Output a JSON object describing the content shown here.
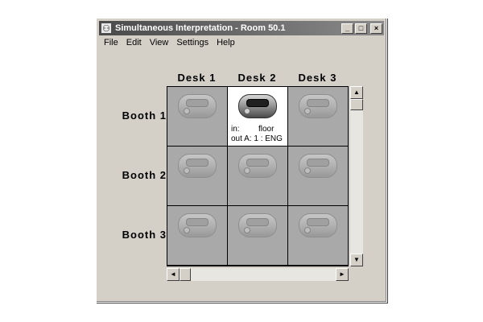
{
  "window": {
    "title": "Simultaneous Interpretation - Room 50.1",
    "app_icon": "interpreter-icon",
    "controls": {
      "minimize": "_",
      "maximize": "□",
      "close": "×"
    }
  },
  "menu": [
    "File",
    "Edit",
    "View",
    "Settings",
    "Help"
  ],
  "columns": [
    "Desk   1",
    "Desk   2",
    "Desk   3"
  ],
  "rows": [
    "Booth   1",
    "Booth   2",
    "Booth   3"
  ],
  "active_cell": {
    "booth": 1,
    "desk": 2,
    "in_label": "in:",
    "in_value": "floor",
    "out_label": "out A:",
    "out_value": "1 : ENG"
  },
  "scroll": {
    "up": "▲",
    "down": "▼",
    "left": "◄",
    "right": "►"
  }
}
